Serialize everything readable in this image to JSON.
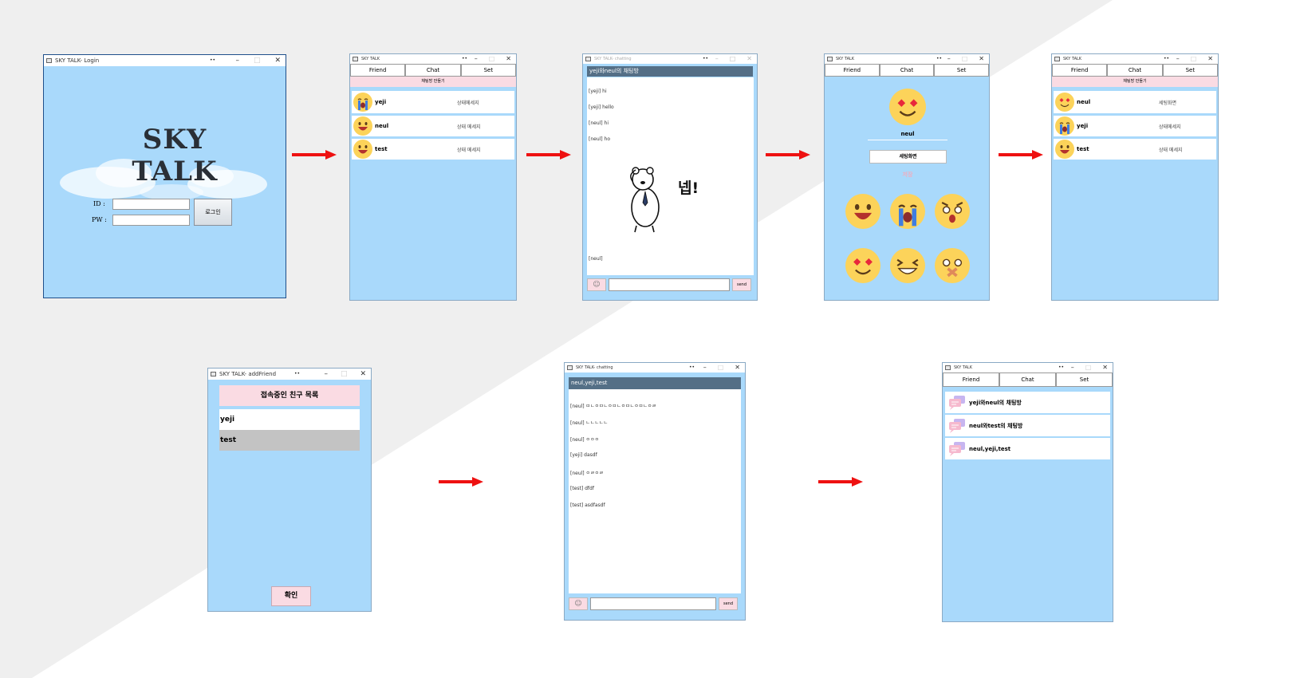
{
  "login_window": {
    "title": "SKY TALK- Login",
    "logo": "SKY TALK",
    "id_label": "ID :",
    "pw_label": "PW :",
    "login_button": "로그인"
  },
  "friend_window": {
    "title": "SKY TALK",
    "tabs": [
      "Friend",
      "Chat",
      "Set"
    ],
    "make_room_label": "채팅방 만들기",
    "friends": [
      {
        "name": "yeji",
        "status": "상태메세지",
        "icon": "crying-emoji-icon"
      },
      {
        "name": "neul",
        "status": "상태 메세지",
        "icon": "happy-emoji-icon"
      },
      {
        "name": "test",
        "status": "상태 메세지",
        "icon": "happy-emoji-icon"
      }
    ]
  },
  "chat_window_1": {
    "title": "SKY TALK- chatting",
    "header": "yeji와neul의 채팅방",
    "messages": [
      "[yeji] hi",
      "[yeji] hello",
      "[neul] hi",
      "[neul] ho"
    ],
    "sticker_text": "넵!",
    "sticker_sender": "[neul]",
    "send_label": "send"
  },
  "set_window": {
    "title": "SKY TALK",
    "tabs": [
      "Friend",
      "Chat",
      "Set"
    ],
    "name": "neul",
    "status_value": "세팅화면",
    "save_label": "저장",
    "emoji_options": [
      "happy-emoji-icon",
      "crying-emoji-icon",
      "shocked-emoji-icon",
      "heart-eyes-emoji-icon",
      "laughing-emoji-icon",
      "muted-emoji-icon"
    ]
  },
  "friend_window_2": {
    "title": "SKY TALK",
    "tabs": [
      "Friend",
      "Chat",
      "Set"
    ],
    "make_room_label": "채팅방 만들기",
    "friends": [
      {
        "name": "neul",
        "status": "세팅화면",
        "icon": "heart-eyes-emoji-icon"
      },
      {
        "name": "yeji",
        "status": "상태메세지",
        "icon": "crying-emoji-icon"
      },
      {
        "name": "test",
        "status": "상태 메세지",
        "icon": "happy-emoji-icon"
      }
    ]
  },
  "add_friend_window": {
    "title": "SKY TALK- addFriend",
    "header": "접속중인 친구 목록",
    "friends": [
      "yeji",
      "test"
    ],
    "selected": "test",
    "confirm_button": "확인"
  },
  "chat_window_2": {
    "title": "SKY TALK- chatting",
    "header": "neul,yeji,test",
    "messages": [
      "[neul] ㅁㄴㅇㅁㄴㅇㅁㄴㅇㅁㄴㅇㅁㄴㅇㄹ",
      "[neul] ㄴㄴㄴㄴㄴ",
      "[neul] ㅇㅇㅇ",
      "[yeji] dasdf",
      "[neul] ㅇㄹㅇㄹ",
      "[test] dfdf",
      "[test] asdfasdf"
    ],
    "send_label": "send"
  },
  "chat_list_window": {
    "title": "SKY TALK",
    "tabs": [
      "Friend",
      "Chat",
      "Set"
    ],
    "rooms": [
      "yeji와neul의 채팅방",
      "neul와test의 채팅방",
      "neul,yeji,test"
    ]
  },
  "colors": {
    "window_bg": "#a9d9fb",
    "pink": "#fadbe3",
    "chat_header": "#546f86",
    "arrow": "#ee1111",
    "emoji": "#fcd35a"
  }
}
